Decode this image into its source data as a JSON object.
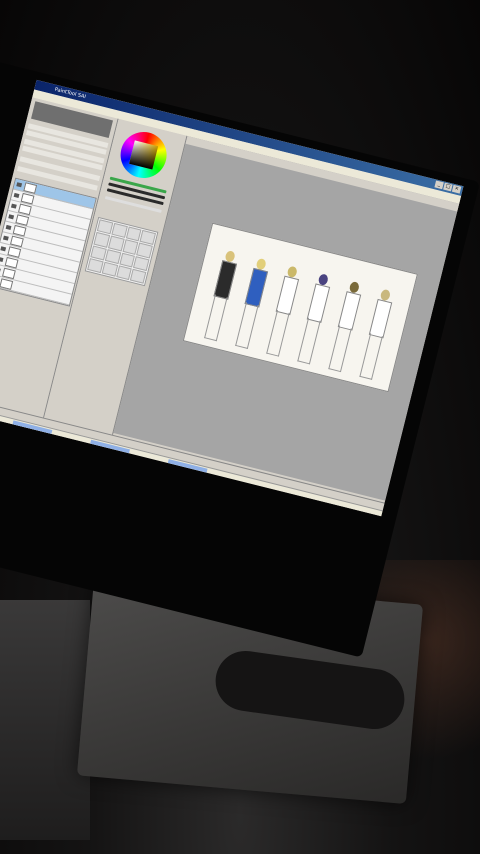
{
  "window": {
    "title": "PaintTool SAI",
    "buttons": [
      "_",
      "□",
      "×"
    ]
  },
  "menubar": {
    "items": [
      "",
      "",
      "",
      "",
      "",
      "",
      ""
    ]
  },
  "left_panel": {
    "props": [
      "",
      "",
      "",
      "",
      "",
      ""
    ],
    "layers": [
      {
        "name": "",
        "selected": true
      },
      {
        "name": "",
        "selected": false
      },
      {
        "name": "",
        "selected": false
      },
      {
        "name": "",
        "selected": false
      },
      {
        "name": "",
        "selected": false
      },
      {
        "name": "",
        "selected": false
      },
      {
        "name": "",
        "selected": false
      },
      {
        "name": "",
        "selected": false
      },
      {
        "name": "",
        "selected": false
      },
      {
        "name": "",
        "selected": false
      }
    ]
  },
  "mid_panel": {
    "slider_colors": [
      "#3aa64a",
      "#2a2a2a",
      "#2a2a2a",
      "#dedede"
    ],
    "tool_option_lines": [
      "",
      "",
      "",
      "",
      "",
      ""
    ]
  },
  "canvas_toolbar": {
    "items": [
      "",
      "",
      "",
      "",
      "",
      ""
    ]
  },
  "artwork": {
    "figures": [
      {
        "hair": "#d9c27a",
        "top": "#2b2b2b"
      },
      {
        "hair": "#e2cf7a",
        "top": "#2f5fbf"
      },
      {
        "hair": "#cbb96a",
        "top": "#ffffff"
      },
      {
        "hair": "#4a4380",
        "top": "#ffffff"
      },
      {
        "hair": "#7a6a3a",
        "top": "#ffffff"
      },
      {
        "hair": "#c9b87e",
        "top": "#ffffff"
      }
    ]
  },
  "statusbar": {
    "text": ""
  },
  "taskbar": {
    "items": [
      "",
      "",
      "",
      ""
    ]
  },
  "colors": {
    "titlebar_start": "#0a246a",
    "titlebar_end": "#3a6ea5",
    "canvas_bg": "#a5a5a5",
    "panel_bg": "#d4d0c8"
  }
}
